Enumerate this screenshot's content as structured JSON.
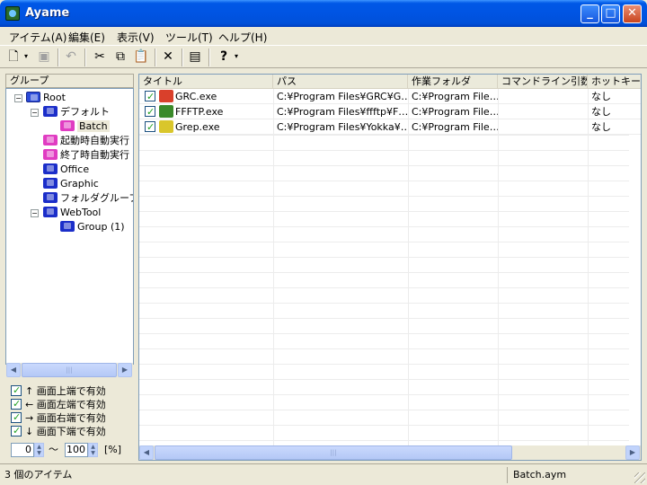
{
  "window": {
    "title": "Ayame"
  },
  "menu": [
    "アイテム(A)",
    "編集(E)",
    "表示(V)",
    "ツール(T)",
    "ヘルプ(H)"
  ],
  "tree": {
    "header": "グループ",
    "items": [
      {
        "label": "Root",
        "color": "root"
      },
      {
        "label": "デフォルト",
        "color": "blue"
      },
      {
        "label": "Batch",
        "color": "pink"
      },
      {
        "label": "起動時自動実行",
        "color": "pink"
      },
      {
        "label": "終了時自動実行",
        "color": "pink"
      },
      {
        "label": "Office",
        "color": "blue"
      },
      {
        "label": "Graphic",
        "color": "blue"
      },
      {
        "label": "フォルダグループ",
        "color": "blue"
      },
      {
        "label": "WebTool",
        "color": "blue"
      },
      {
        "label": "Group (1)",
        "color": "blue"
      }
    ]
  },
  "edge_options": [
    {
      "label": "↑ 画面上端で有効",
      "checked": true
    },
    {
      "label": "← 画面左端で有効",
      "checked": true
    },
    {
      "label": "→ 画面右端で有効",
      "checked": true
    },
    {
      "label": "↓ 画面下端で有効",
      "checked": true
    }
  ],
  "range": {
    "min": "0",
    "tilde": "〜",
    "max": "100",
    "unit": "[%]"
  },
  "list": {
    "columns": [
      "タイトル",
      "パス",
      "作業フォルダ",
      "コマンドライン引数",
      "ホットキー"
    ],
    "rows": [
      {
        "title": "GRC.exe",
        "path": "C:¥Program Files¥GRC¥G…",
        "workdir": "C:¥Program File…",
        "args": "",
        "hotkey": "なし",
        "checked": true,
        "icon_color": "#d9402b"
      },
      {
        "title": "FFFTP.exe",
        "path": "C:¥Program Files¥ffftp¥F…",
        "workdir": "C:¥Program File…",
        "args": "",
        "hotkey": "なし",
        "checked": true,
        "icon_color": "#3a8a2a"
      },
      {
        "title": "Grep.exe",
        "path": "C:¥Program Files¥Yokka¥…",
        "workdir": "C:¥Program File…",
        "args": "",
        "hotkey": "なし",
        "checked": true,
        "icon_color": "#d9c62b"
      }
    ]
  },
  "status": {
    "items_count": "3 個のアイテム",
    "file": "Batch.aym"
  }
}
